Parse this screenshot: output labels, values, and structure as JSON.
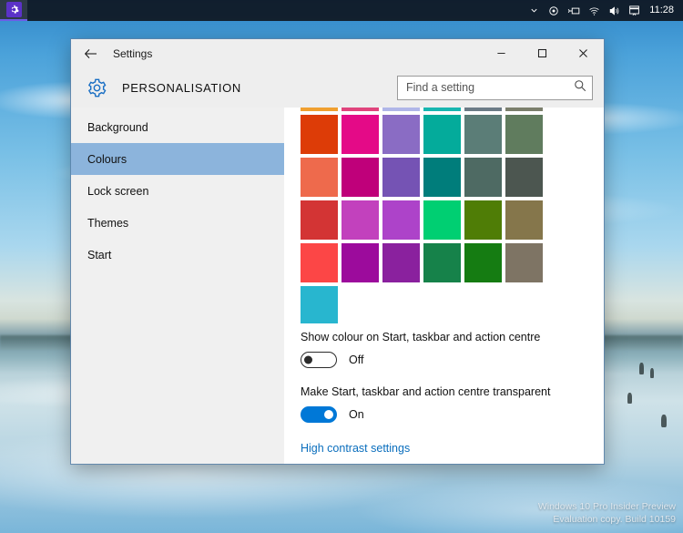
{
  "taskbar": {
    "app_icon": "settings-gear-icon",
    "tray_icons": [
      "chevron-up-icon",
      "onedrive-icon",
      "network-adapter-icon",
      "wifi-icon",
      "volume-icon",
      "action-centre-icon"
    ],
    "clock": "11:28"
  },
  "window": {
    "title": "Settings",
    "back_icon": "back-arrow-icon",
    "controls": {
      "minimize": "─",
      "maximize": "☐",
      "close": "✕"
    },
    "category_icon": "gear-icon",
    "category_title": "PERSONALISATION"
  },
  "search": {
    "placeholder": "Find a setting",
    "value": "",
    "icon": "search-icon"
  },
  "sidebar": {
    "items": [
      {
        "label": "Background",
        "selected": false
      },
      {
        "label": "Colours",
        "selected": true
      },
      {
        "label": "Lock screen",
        "selected": false
      },
      {
        "label": "Themes",
        "selected": false
      },
      {
        "label": "Start",
        "selected": false
      }
    ],
    "selected_colour": "#8cb4dc"
  },
  "colour_grid": {
    "columns": 6,
    "rows": [
      [
        "#f0a030",
        "#e0447c",
        "#b0b6e8",
        "#17b6b0",
        "#6c7b86",
        "#7b7f6c"
      ],
      [
        "#dd3c07",
        "#e40a87",
        "#8a6cc4",
        "#04ab9b",
        "#5b7d77",
        "#607c5e"
      ],
      [
        "#ee6a4c",
        "#bf007a",
        "#7553b4",
        "#007d7b",
        "#4e6a63",
        "#4c5650"
      ],
      [
        "#d33434",
        "#c241bd",
        "#ad43c9",
        "#00cf72",
        "#4f7d06",
        "#85764b"
      ],
      [
        "#fc4646",
        "#9c0b9c",
        "#8a219e",
        "#16824a",
        "#157c12",
        "#7e7464"
      ],
      [
        "#28b6cf"
      ]
    ],
    "scrolled": true
  },
  "options": [
    {
      "label": "Show colour on Start, taskbar and action centre",
      "state": "Off",
      "on": false
    },
    {
      "label": "Make Start, taskbar and action centre transparent",
      "state": "On",
      "on": true
    }
  ],
  "links": {
    "high_contrast": "High contrast settings",
    "link_colour": "#0a6ebd"
  },
  "watermark": {
    "line1": "Windows 10 Pro Insider Preview",
    "line2": "Evaluation copy. Build 10159"
  }
}
